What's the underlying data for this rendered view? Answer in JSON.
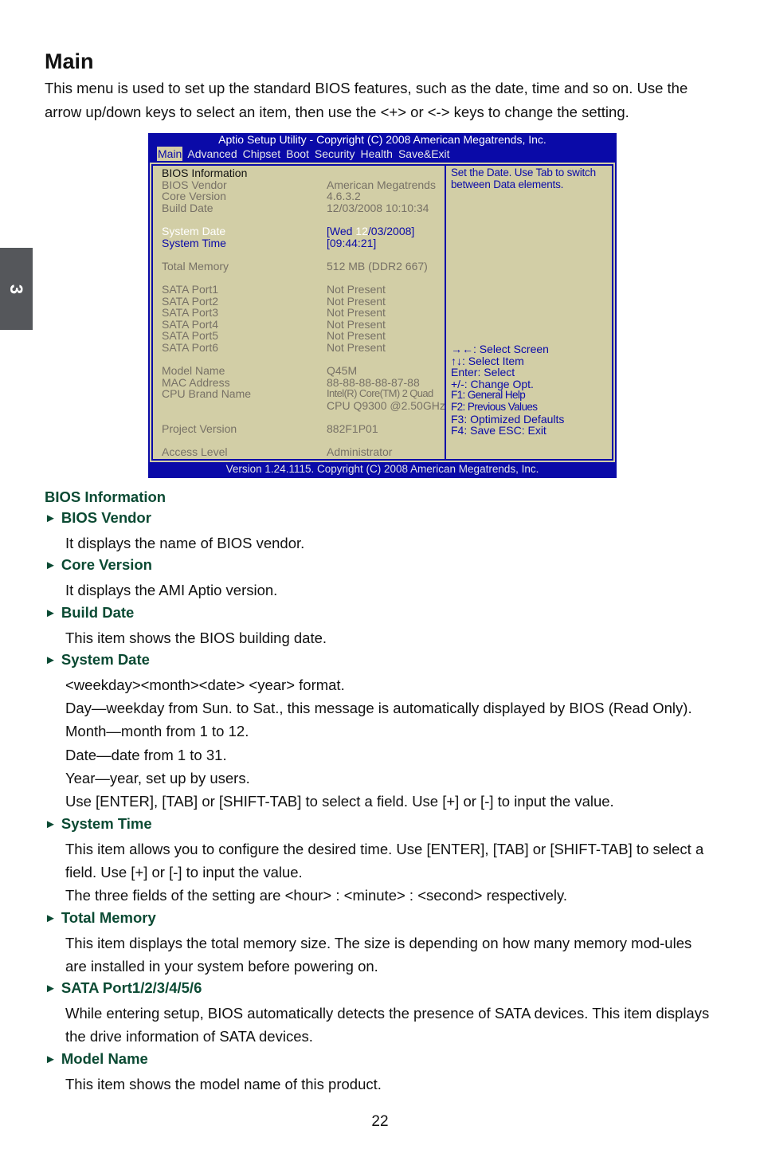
{
  "chapter_tab": "3",
  "page_title": "Main",
  "intro": "This menu is used to set up the standard BIOS features, such as the date, time and so on. Use the arrow up/down keys to select an item, then use the <+> or <-> keys to change the setting.",
  "bios": {
    "title": "Aptio Setup Utility - Copyright (C) 2008 American Megatrends, Inc.",
    "menu": [
      "Main",
      "Advanced",
      "Chipset",
      "Boot",
      "Security",
      "Health",
      "Save&Exit"
    ],
    "active_menu": "Main",
    "section_header": "BIOS Information",
    "info_rows": [
      {
        "label": "BIOS Vendor",
        "value": "American Megatrends"
      },
      {
        "label": "Core Version",
        "value": "4.6.3.2"
      },
      {
        "label": "Build Date",
        "value": "12/03/2008 10:10:34"
      }
    ],
    "system_date": {
      "label": "System Date",
      "open": "[Wed ",
      "highlight": "12",
      "rest": "/03/2008]"
    },
    "system_time": {
      "label": "System Time",
      "value": "[09:44:21]"
    },
    "total_memory": {
      "label": "Total Memory",
      "value": "512 MB (DDR2 667)"
    },
    "sata_rows": [
      {
        "label": "SATA Port1",
        "value": "Not Present"
      },
      {
        "label": "SATA Port2",
        "value": "Not Present"
      },
      {
        "label": "SATA Port3",
        "value": "Not Present"
      },
      {
        "label": "SATA Port4",
        "value": "Not Present"
      },
      {
        "label": "SATA Port5",
        "value": "Not Present"
      },
      {
        "label": "SATA Port6",
        "value": "Not Present"
      }
    ],
    "model_name": {
      "label": "Model Name",
      "value": "Q45M"
    },
    "mac_address": {
      "label": "MAC Address",
      "value": "88-88-88-88-87-88"
    },
    "cpu_brand": {
      "label": "CPU Brand Name",
      "value_line1": "Intel(R) Core(TM) 2 Quad",
      "value_line2": "CPU Q9300 @2.50GHz"
    },
    "project_version": {
      "label": "Project Version",
      "value": "882F1P01"
    },
    "access_level": {
      "label": "Access Level",
      "value": "Administrator"
    },
    "help_text": [
      "Set the Date. Use Tab to switch",
      "between Data elements."
    ],
    "keys": [
      "→←: Select Screen",
      "↑↓: Select Item",
      "Enter: Select",
      "+/-: Change Opt.",
      "F1:  General Help",
      "F2:  Previous Values",
      "F3: Optimized Defaults",
      "F4: Save  ESC: Exit"
    ],
    "footer": "Version 1.24.1115. Copyright (C) 2008 American Megatrends, Inc."
  },
  "descriptions": {
    "section_heading": "BIOS Information",
    "arrow_glyph": "►",
    "items": [
      {
        "heading": "BIOS Vendor",
        "paragraphs": [
          "It displays the name of BIOS vendor."
        ]
      },
      {
        "heading": "Core Version",
        "paragraphs": [
          "It displays the AMI Aptio version."
        ]
      },
      {
        "heading": "Build Date",
        "paragraphs": [
          "This item shows the BIOS building date."
        ]
      },
      {
        "heading": "System Date",
        "paragraphs": [
          "<weekday><month><date> <year> format.",
          "Day—weekday from Sun. to Sat., this message is automatically displayed by BIOS (Read Only).",
          "Month—month from 1 to 12.",
          "Date—date from 1 to 31.",
          "Year—year, set up by users.",
          "Use [ENTER], [TAB] or [SHIFT-TAB] to select a field. Use [+] or [-] to input the value."
        ]
      },
      {
        "heading": "System Time",
        "paragraphs": [
          "This item allows you to configure the desired time. Use [ENTER], [TAB] or [SHIFT-TAB] to select a field. Use [+] or [-] to input the value.",
          "The three fields of the setting are <hour> : <minute> : <second> respectively."
        ]
      },
      {
        "heading": "Total Memory",
        "paragraphs": [
          "This item displays the total memory size. The size is depending on how many memory mod-ules are installed in your system before powering on."
        ]
      },
      {
        "heading": "SATA Port1/2/3/4/5/6",
        "paragraphs": [
          "While entering setup, BIOS automatically detects the presence of SATA devices. This item displays the drive information of SATA devices."
        ]
      },
      {
        "heading": "Model Name",
        "paragraphs": [
          "This item shows the model name of this product."
        ]
      }
    ]
  },
  "page_number": "22",
  "colors": {
    "bios_blue": "#0a0aa8",
    "bios_panel": "#d2cea6",
    "bios_gray_text": "#777166",
    "heading_green": "#0b4a33",
    "chapter_tab_gray": "#55575b"
  }
}
